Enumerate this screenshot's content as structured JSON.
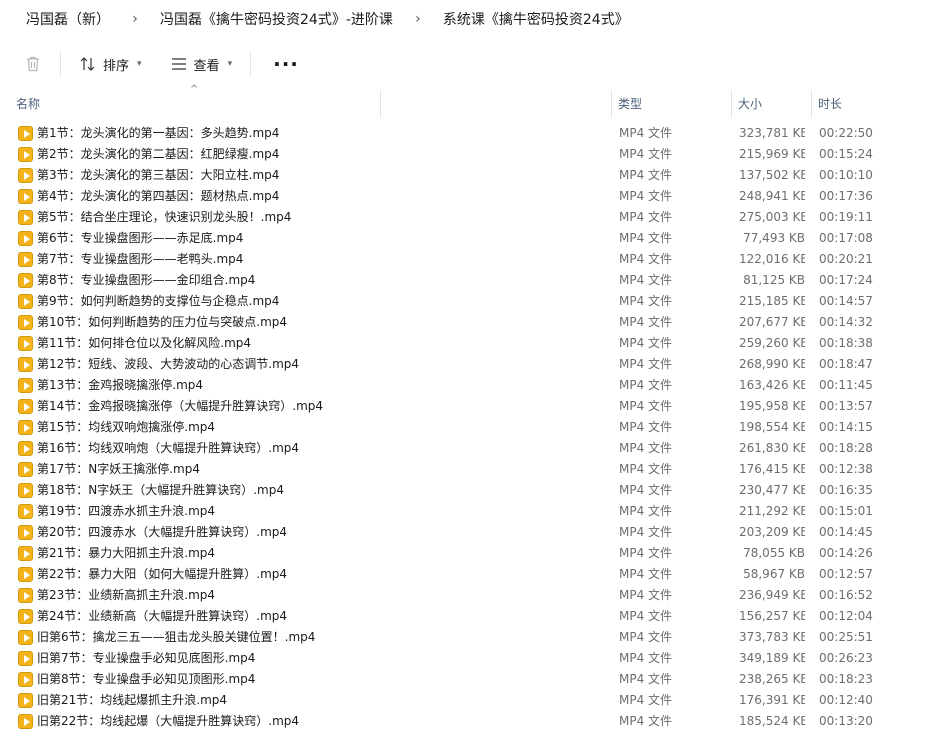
{
  "breadcrumb": [
    "冯国磊（新）",
    "冯国磊《擒牛密码投资24式》-进阶课",
    "系统课《擒牛密码投资24式》"
  ],
  "toolbar": {
    "sort_label": "排序",
    "view_label": "查看",
    "more_label": "···"
  },
  "columns": {
    "name": "名称",
    "type": "类型",
    "size": "大小",
    "duration": "时长"
  },
  "files": [
    {
      "name": "第1节：龙头演化的第一基因：多头趋势.mp4",
      "type": "MP4 文件",
      "size": "323,781 KB",
      "duration": "00:22:50"
    },
    {
      "name": "第2节：龙头演化的第二基因：红肥绿瘦.mp4",
      "type": "MP4 文件",
      "size": "215,969 KB",
      "duration": "00:15:24"
    },
    {
      "name": "第3节：龙头演化的第三基因：大阳立柱.mp4",
      "type": "MP4 文件",
      "size": "137,502 KB",
      "duration": "00:10:10"
    },
    {
      "name": "第4节：龙头演化的第四基因：题材热点.mp4",
      "type": "MP4 文件",
      "size": "248,941 KB",
      "duration": "00:17:36"
    },
    {
      "name": "第5节：结合坐庄理论，快速识别龙头股！.mp4",
      "type": "MP4 文件",
      "size": "275,003 KB",
      "duration": "00:19:11"
    },
    {
      "name": "第6节：专业操盘图形——赤足底.mp4",
      "type": "MP4 文件",
      "size": "77,493 KB",
      "duration": "00:17:08"
    },
    {
      "name": "第7节：专业操盘图形——老鸭头.mp4",
      "type": "MP4 文件",
      "size": "122,016 KB",
      "duration": "00:20:21"
    },
    {
      "name": "第8节：专业操盘图形——金印组合.mp4",
      "type": "MP4 文件",
      "size": "81,125 KB",
      "duration": "00:17:24"
    },
    {
      "name": "第9节：如何判断趋势的支撑位与企稳点.mp4",
      "type": "MP4 文件",
      "size": "215,185 KB",
      "duration": "00:14:57"
    },
    {
      "name": "第10节：如何判断趋势的压力位与突破点.mp4",
      "type": "MP4 文件",
      "size": "207,677 KB",
      "duration": "00:14:32"
    },
    {
      "name": "第11节：如何排仓位以及化解风险.mp4",
      "type": "MP4 文件",
      "size": "259,260 KB",
      "duration": "00:18:38"
    },
    {
      "name": "第12节：短线、波段、大势波动的心态调节.mp4",
      "type": "MP4 文件",
      "size": "268,990 KB",
      "duration": "00:18:47"
    },
    {
      "name": "第13节：金鸡报晓擒涨停.mp4",
      "type": "MP4 文件",
      "size": "163,426 KB",
      "duration": "00:11:45"
    },
    {
      "name": "第14节：金鸡报晓擒涨停（大幅提升胜算诀窍）.mp4",
      "type": "MP4 文件",
      "size": "195,958 KB",
      "duration": "00:13:57"
    },
    {
      "name": "第15节：均线双响炮擒涨停.mp4",
      "type": "MP4 文件",
      "size": "198,554 KB",
      "duration": "00:14:15"
    },
    {
      "name": "第16节：均线双响炮（大幅提升胜算诀窍）.mp4",
      "type": "MP4 文件",
      "size": "261,830 KB",
      "duration": "00:18:28"
    },
    {
      "name": "第17节：N字妖王擒涨停.mp4",
      "type": "MP4 文件",
      "size": "176,415 KB",
      "duration": "00:12:38"
    },
    {
      "name": "第18节：N字妖王（大幅提升胜算诀窍）.mp4",
      "type": "MP4 文件",
      "size": "230,477 KB",
      "duration": "00:16:35"
    },
    {
      "name": "第19节：四渡赤水抓主升浪.mp4",
      "type": "MP4 文件",
      "size": "211,292 KB",
      "duration": "00:15:01"
    },
    {
      "name": "第20节：四渡赤水（大幅提升胜算诀窍）.mp4",
      "type": "MP4 文件",
      "size": "203,209 KB",
      "duration": "00:14:45"
    },
    {
      "name": "第21节：暴力大阳抓主升浪.mp4",
      "type": "MP4 文件",
      "size": "78,055 KB",
      "duration": "00:14:26"
    },
    {
      "name": "第22节：暴力大阳（如何大幅提升胜算）.mp4",
      "type": "MP4 文件",
      "size": "58,967 KB",
      "duration": "00:12:57"
    },
    {
      "name": "第23节：业绩新高抓主升浪.mp4",
      "type": "MP4 文件",
      "size": "236,949 KB",
      "duration": "00:16:52"
    },
    {
      "name": "第24节：业绩新高（大幅提升胜算诀窍）.mp4",
      "type": "MP4 文件",
      "size": "156,257 KB",
      "duration": "00:12:04"
    },
    {
      "name": "旧第6节：擒龙三五——狙击龙头股关键位置！.mp4",
      "type": "MP4 文件",
      "size": "373,783 KB",
      "duration": "00:25:51"
    },
    {
      "name": "旧第7节：专业操盘手必知见底图形.mp4",
      "type": "MP4 文件",
      "size": "349,189 KB",
      "duration": "00:26:23"
    },
    {
      "name": "旧第8节：专业操盘手必知见顶图形.mp4",
      "type": "MP4 文件",
      "size": "238,265 KB",
      "duration": "00:18:23"
    },
    {
      "name": "旧第21节：均线起爆抓主升浪.mp4",
      "type": "MP4 文件",
      "size": "176,391 KB",
      "duration": "00:12:40"
    },
    {
      "name": "旧第22节：均线起爆（大幅提升胜算诀窍）.mp4",
      "type": "MP4 文件",
      "size": "185,524 KB",
      "duration": "00:13:20"
    }
  ]
}
